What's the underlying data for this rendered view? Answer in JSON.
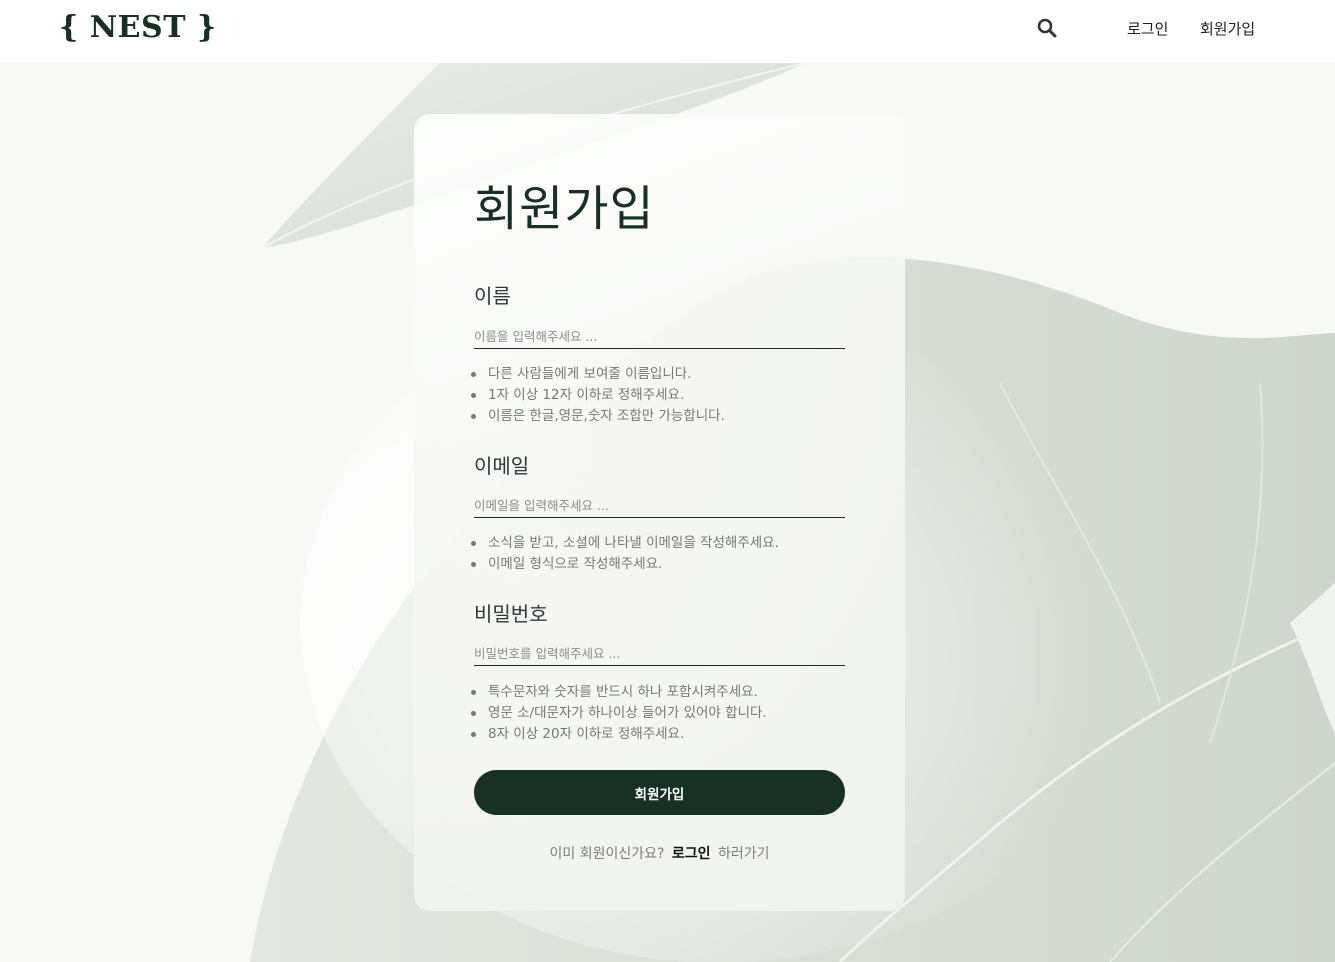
{
  "header": {
    "logo": "{ NEST }",
    "search_icon": "search-icon",
    "nav": {
      "login": "로그인",
      "signup": "회원가입"
    }
  },
  "form": {
    "title": "회원가입",
    "fields": [
      {
        "label": "이름",
        "placeholder": "이름을 입력해주세요 ...",
        "value": "",
        "hints": [
          "다른 사람들에게 보여줄 이름입니다.",
          "1자 이상 12자 이하로 정해주세요.",
          "이름은 한글,영문,숫자 조합만 가능합니다."
        ]
      },
      {
        "label": "이메일",
        "placeholder": "이메일을 입력해주세요 ...",
        "value": "",
        "hints": [
          "소식을 받고, 소셜에 나타낼 이메일을 작성해주세요.",
          "이메일 형식으로 작성해주세요."
        ]
      },
      {
        "label": "비밀번호",
        "placeholder": "비밀번호를 입력해주세요 ...",
        "value": "",
        "hints": [
          "특수문자와 숫자를 반드시 하나 포함시켜주세요.",
          "영문 소/대문자가 하나이상 들어가 있어야 합니다.",
          "8자 이상 20자 이하로 정해주세요."
        ]
      }
    ],
    "submit_label": "회원가입",
    "footer": {
      "prefix": "이미 회원이신가요?",
      "link": "로그인",
      "suffix": "하러가기"
    }
  },
  "colors": {
    "brand": "#163024",
    "hint_text": "#747a77",
    "background": "#f7f8f6"
  }
}
